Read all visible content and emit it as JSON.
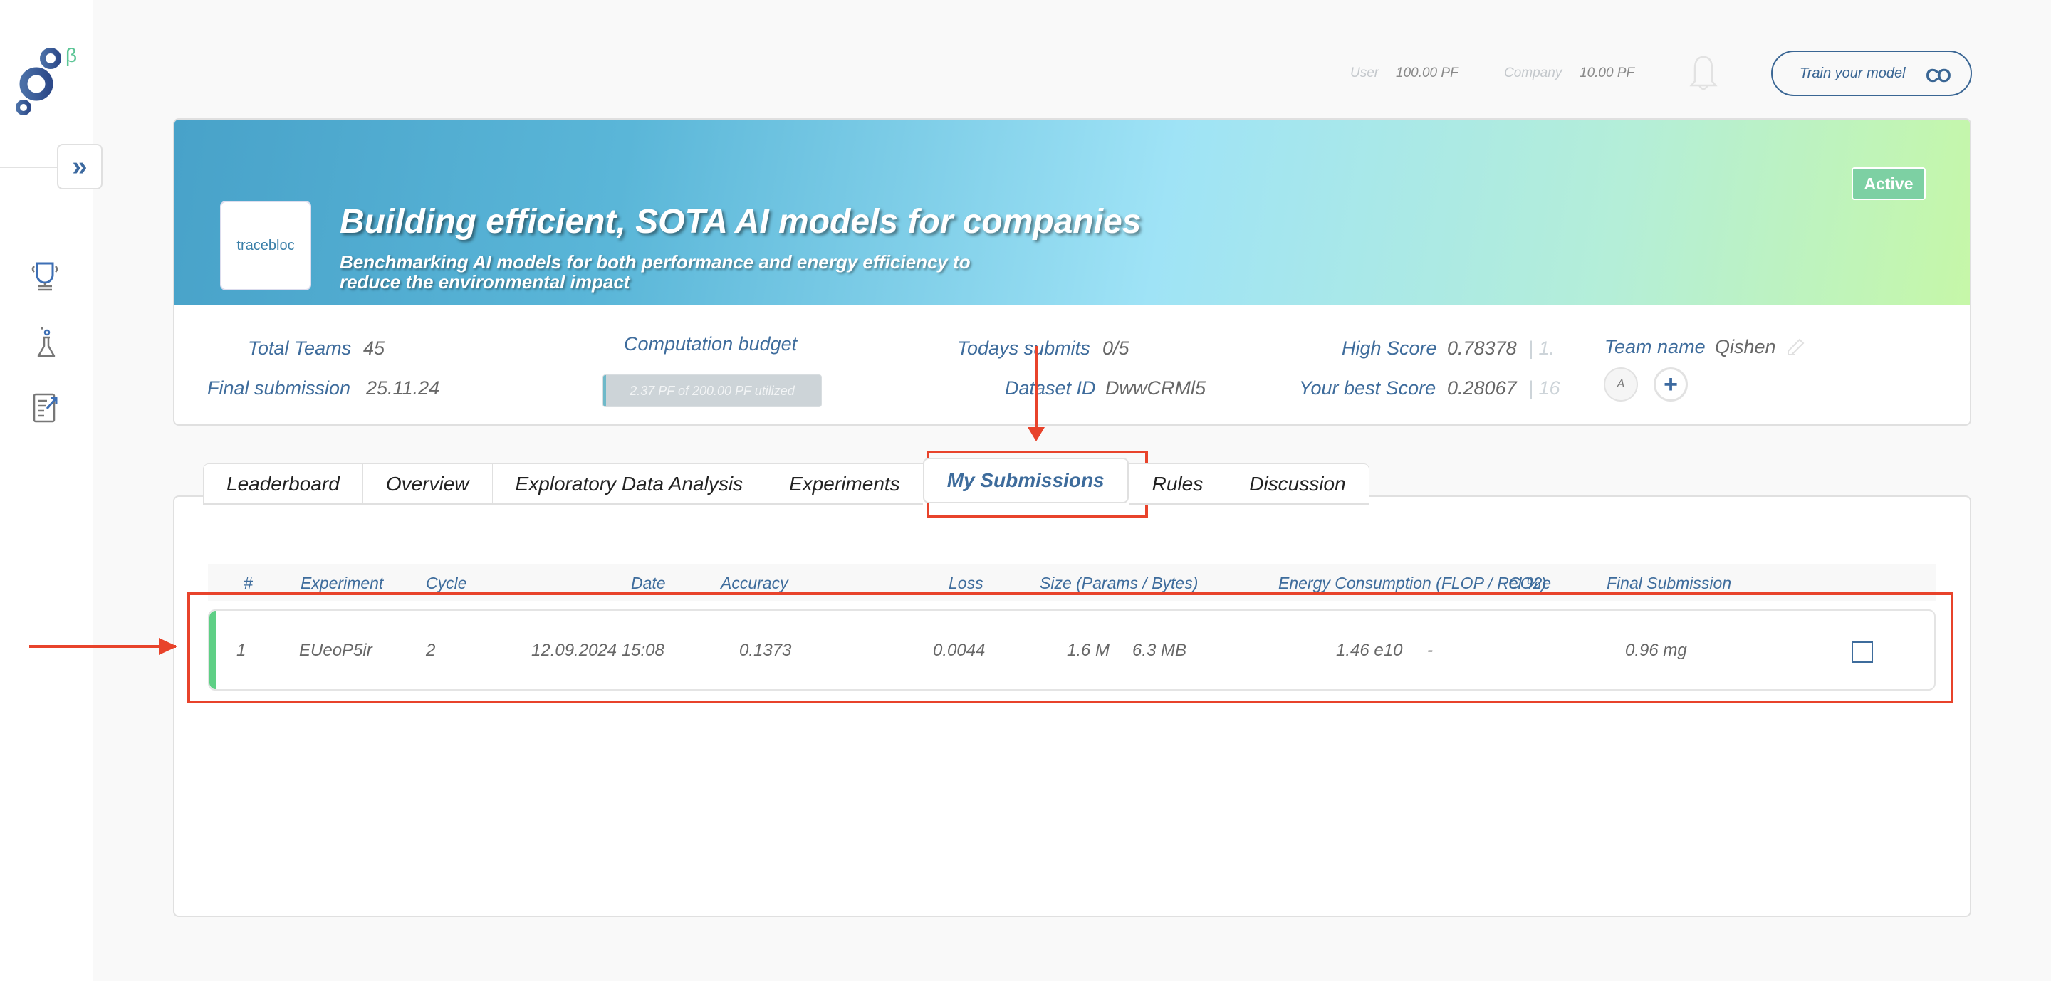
{
  "sidebar": {
    "logo_superscript": "β",
    "expand_glyph": "»",
    "nav_icons": [
      "trophy-icon",
      "flask-icon",
      "document-edit-icon"
    ]
  },
  "topbar": {
    "user_label": "User",
    "user_value": "100.00 PF",
    "company_label": "Company",
    "company_value": "10.00 PF",
    "train_button": "Train your model",
    "train_button_glyph": "CO"
  },
  "banner": {
    "logo_text": "tracebloc",
    "title": "Building efficient, SOTA AI models for companies",
    "subtitle": "Benchmarking AI models for both performance and energy efficiency to reduce the environmental impact",
    "status": "Active"
  },
  "stats": {
    "total_teams_label": "Total Teams",
    "total_teams_value": "45",
    "final_submission_label": "Final submission",
    "final_submission_value": "25.11.24",
    "budget_label": "Computation budget",
    "budget_text": "2.37 PF of 200.00 PF utilized",
    "budget_used_fraction": 0.01185,
    "todays_submits_label": "Todays submits",
    "todays_submits_value": "0/5",
    "dataset_id_label": "Dataset ID",
    "dataset_id_value": "DwwCRMl5",
    "high_score_label": "High Score",
    "high_score_value": "0.78378",
    "high_score_rank": "| 1.",
    "best_score_label": "Your best Score",
    "best_score_value": "0.28067",
    "best_score_rank": "| 16",
    "team_name_label": "Team name",
    "team_name_value": "Qishen",
    "member_initial": "A",
    "add_member_glyph": "+"
  },
  "tabs": [
    {
      "label": "Leaderboard",
      "active": false
    },
    {
      "label": "Overview",
      "active": false
    },
    {
      "label": "Exploratory Data Analysis",
      "active": false
    },
    {
      "label": "Experiments",
      "active": false
    },
    {
      "label": "My Submissions",
      "active": true
    },
    {
      "label": "Rules",
      "active": false
    },
    {
      "label": "Discussion",
      "active": false
    }
  ],
  "table": {
    "headers": [
      "#",
      "Experiment",
      "Cycle",
      "Date",
      "Accuracy",
      "Loss",
      "Size (Params / Bytes)",
      "Energy Consumption (FLOP / Rel %)",
      "CO2e",
      "Final Submission"
    ],
    "rows": [
      {
        "index": "1",
        "experiment": "EUeoP5ir",
        "cycle": "2",
        "date": "12.09.2024 15:08",
        "accuracy": "0.1373",
        "loss": "0.0044",
        "params": "1.6 M",
        "bytes": "6.3 MB",
        "flop": "1.46 e10",
        "rel": "-",
        "co2e": "0.96 mg",
        "final_submission": false
      }
    ]
  },
  "colors": {
    "accent_blue": "#3e6c9c",
    "status_green": "#7dd0a3",
    "row_accent_green": "#5ecf85",
    "annotation_red": "#e8432b"
  }
}
